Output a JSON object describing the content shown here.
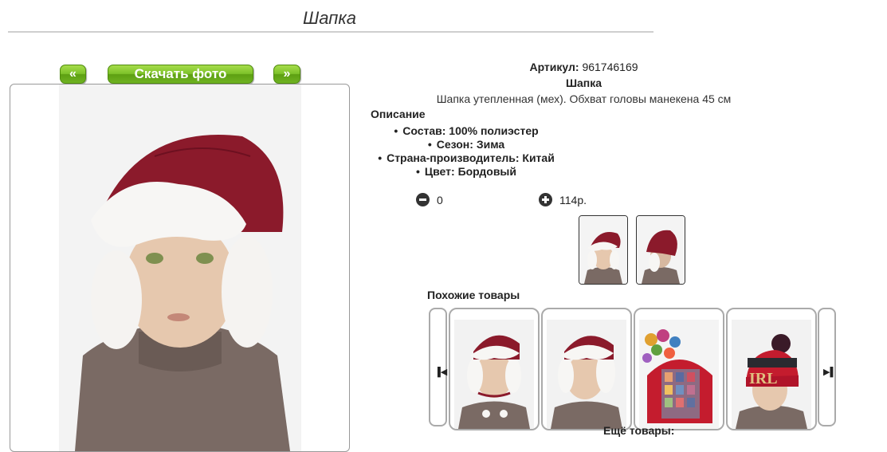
{
  "page": {
    "title": "Шапка"
  },
  "gallery": {
    "prev_label": "«",
    "download_label": "Скачать фото",
    "next_label": "»"
  },
  "product": {
    "article_label": "Артикул:",
    "article_value": "961746169",
    "name": "Шапка",
    "description": "Шапка утепленная (мех). Обхват головы манекена 45 см",
    "description_heading": "Описание",
    "attributes": [
      "Состав: 100% полиэстер",
      "Сезон: Зима",
      "Страна-производитель: Китай",
      "Цвет: Бордовый"
    ]
  },
  "cart": {
    "quantity": "0",
    "price": "114р."
  },
  "similar": {
    "heading": "Похожие товары",
    "more_heading": "Ещё товары:"
  },
  "colors": {
    "accent_green": "#7dc22a",
    "hat_burgundy": "#8b1a2b"
  }
}
